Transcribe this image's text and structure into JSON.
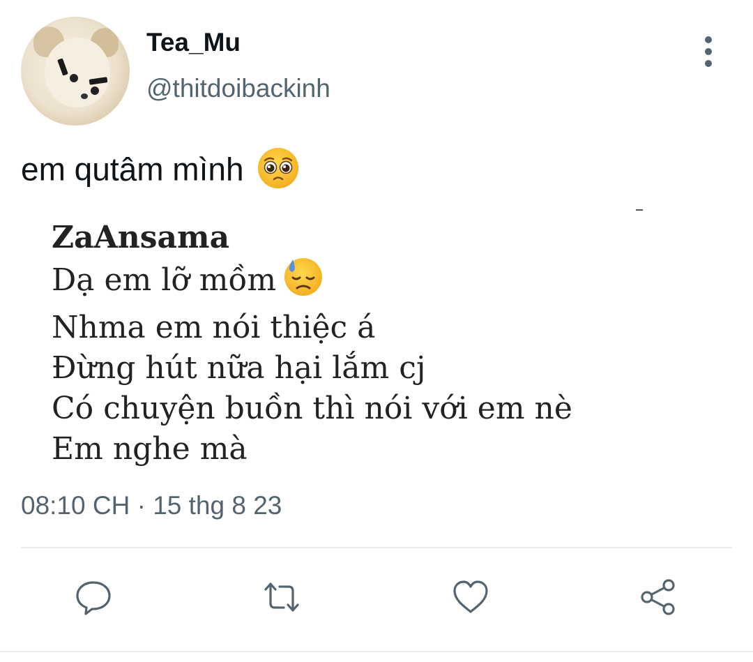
{
  "tweet": {
    "display_name": "Tea_Mu",
    "handle": "@thitdoibackinh",
    "text": "em qutâm mình",
    "text_emoji": "pleading-face",
    "timestamp": "08:10 CH · 15 thg 8 23"
  },
  "quoted_image": {
    "name": "ZaAnsama",
    "lines": [
      "Dạ em lỡ mồm",
      "Nhma em nói thiệc á",
      "Đừng hút nữa hại lắm cj",
      "Có chuyện buồn thì nói với em nè",
      "Em nghe mà"
    ],
    "line1_emoji": "downcast-face-with-sweat"
  },
  "actions": {
    "reply_icon": "reply-icon",
    "retweet_icon": "retweet-icon",
    "like_icon": "heart-icon",
    "share_icon": "share-icon"
  },
  "colors": {
    "text": "#0f1419",
    "secondary": "#536471",
    "divider": "#e6ecf0"
  }
}
